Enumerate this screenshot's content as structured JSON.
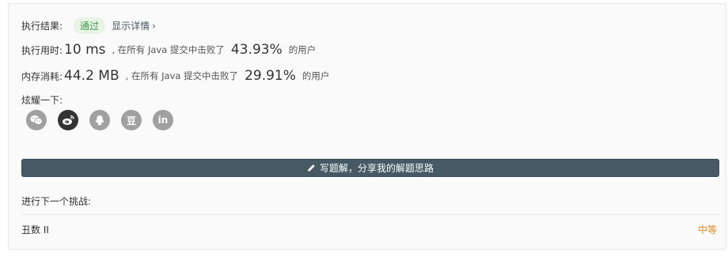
{
  "result": {
    "label": "执行结果:",
    "status": "通过",
    "detail_link": "显示详情",
    "detail_chevron": "›"
  },
  "runtime": {
    "label": "执行用时:",
    "value": "10 ms",
    "beat_text": ", 在所有 Java 提交中击败了",
    "percent": "43.93%",
    "suffix": "的用户"
  },
  "memory": {
    "label": "内存消耗:",
    "value": "44.2 MB",
    "beat_text": ", 在所有 Java 提交中击败了",
    "percent": "29.91%",
    "suffix": "的用户"
  },
  "share": {
    "label": "炫耀一下:",
    "icons": [
      {
        "icon": "wechat-icon",
        "glyph": ""
      },
      {
        "icon": "weibo-icon",
        "glyph": ""
      },
      {
        "icon": "qq-icon",
        "glyph": ""
      },
      {
        "icon": "douban-icon",
        "glyph": "豆"
      },
      {
        "icon": "linkedin-icon",
        "glyph": "in"
      }
    ]
  },
  "write_solution": {
    "icon": "pencil-icon",
    "label": "写题解，分享我的解题思路"
  },
  "next_challenge": {
    "label": "进行下一个挑战:",
    "problem": "丑数 II",
    "difficulty": "中等"
  },
  "colors": {
    "accent": "#455a64",
    "success": "#3c9a4e",
    "medium": "#e08a1e"
  }
}
